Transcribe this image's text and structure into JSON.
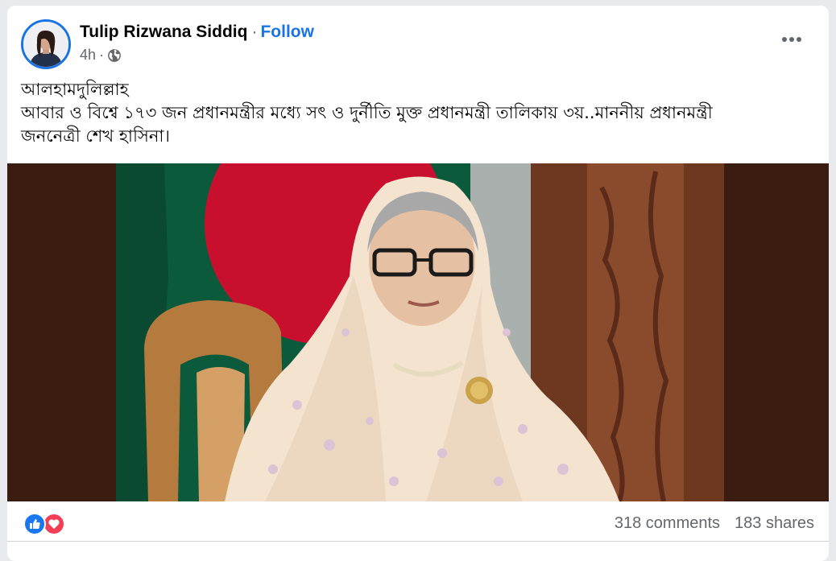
{
  "post": {
    "author": "Tulip Rizwana Siddiq",
    "separator": "·",
    "follow_label": "Follow",
    "time": "4h",
    "time_separator": "·",
    "audience_icon": "globe-icon",
    "more_icon": "more-options-icon",
    "text_lines": [
      "আলহামদুলিল্লাহ",
      "আবার ও বিশ্বে ১৭৩ জন প্রধানমন্ত্রীর মধ্যে সৎ ও দুর্নীতি মুক্ত প্রধানমন্ত্রী তালিকায়  ৩য়..মাননীয় প্রধানমন্ত্রী",
      "জননেত্রী শেখ হাসিনা।"
    ]
  },
  "footer": {
    "reaction_icons": [
      "like-icon",
      "love-icon"
    ],
    "comments": "318 comments",
    "shares": "183 shares"
  },
  "colors": {
    "accent": "#1b74e4",
    "like": "#1877f2",
    "love": "#f33e58",
    "secondary_text": "#65676b",
    "photo_background": "#3b1f12"
  }
}
